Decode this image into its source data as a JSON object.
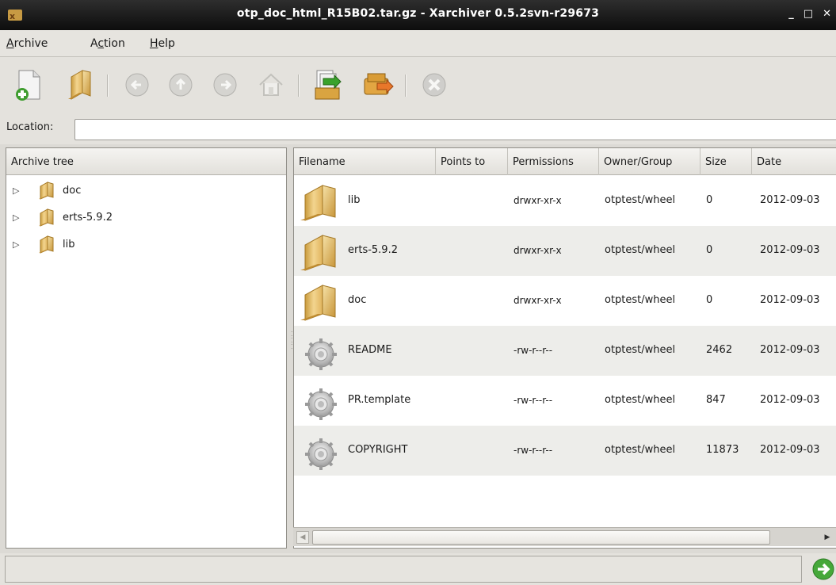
{
  "window": {
    "title": "otp_doc_html_R15B02.tar.gz - Xarchiver 0.5.2svn-r29673",
    "controls": [
      "_",
      "□",
      "✕"
    ]
  },
  "menu": {
    "archive": {
      "mnemonic": "A",
      "rest": "rchive"
    },
    "action": {
      "pre": "A",
      "mnemonic": "c",
      "rest": "tion"
    },
    "help": {
      "mnemonic": "H",
      "rest": "elp"
    }
  },
  "toolbar": {
    "icons": [
      "new-archive-icon",
      "open-archive-icon",
      "back-icon",
      "up-icon",
      "forward-icon",
      "home-icon",
      "extract-icon",
      "add-icon",
      "stop-icon"
    ]
  },
  "location": {
    "label": "Location:",
    "value": ""
  },
  "tree": {
    "header": "Archive tree",
    "items": [
      {
        "label": "doc"
      },
      {
        "label": "erts-5.9.2"
      },
      {
        "label": "lib"
      }
    ]
  },
  "files": {
    "columns": [
      "Filename",
      "Points to",
      "Permissions",
      "Owner/Group",
      "Size",
      "Date"
    ],
    "rows": [
      {
        "type": "folder",
        "name": "lib",
        "points_to": "",
        "permissions": "drwxr-xr-x",
        "owner": "otptest/wheel",
        "size": "0",
        "date": "2012-09-03"
      },
      {
        "type": "folder",
        "name": "erts-5.9.2",
        "points_to": "",
        "permissions": "drwxr-xr-x",
        "owner": "otptest/wheel",
        "size": "0",
        "date": "2012-09-03"
      },
      {
        "type": "folder",
        "name": "doc",
        "points_to": "",
        "permissions": "drwxr-xr-x",
        "owner": "otptest/wheel",
        "size": "0",
        "date": "2012-09-03"
      },
      {
        "type": "file",
        "name": "README",
        "points_to": "",
        "permissions": "-rw-r--r--",
        "owner": "otptest/wheel",
        "size": "2462",
        "date": "2012-09-03"
      },
      {
        "type": "file",
        "name": "PR.template",
        "points_to": "",
        "permissions": "-rw-r--r--",
        "owner": "otptest/wheel",
        "size": "847",
        "date": "2012-09-03"
      },
      {
        "type": "file",
        "name": "COPYRIGHT",
        "points_to": "",
        "permissions": "-rw-r--r--",
        "owner": "otptest/wheel",
        "size": "11873",
        "date": "2012-09-03"
      }
    ]
  },
  "status": {
    "text": ""
  }
}
